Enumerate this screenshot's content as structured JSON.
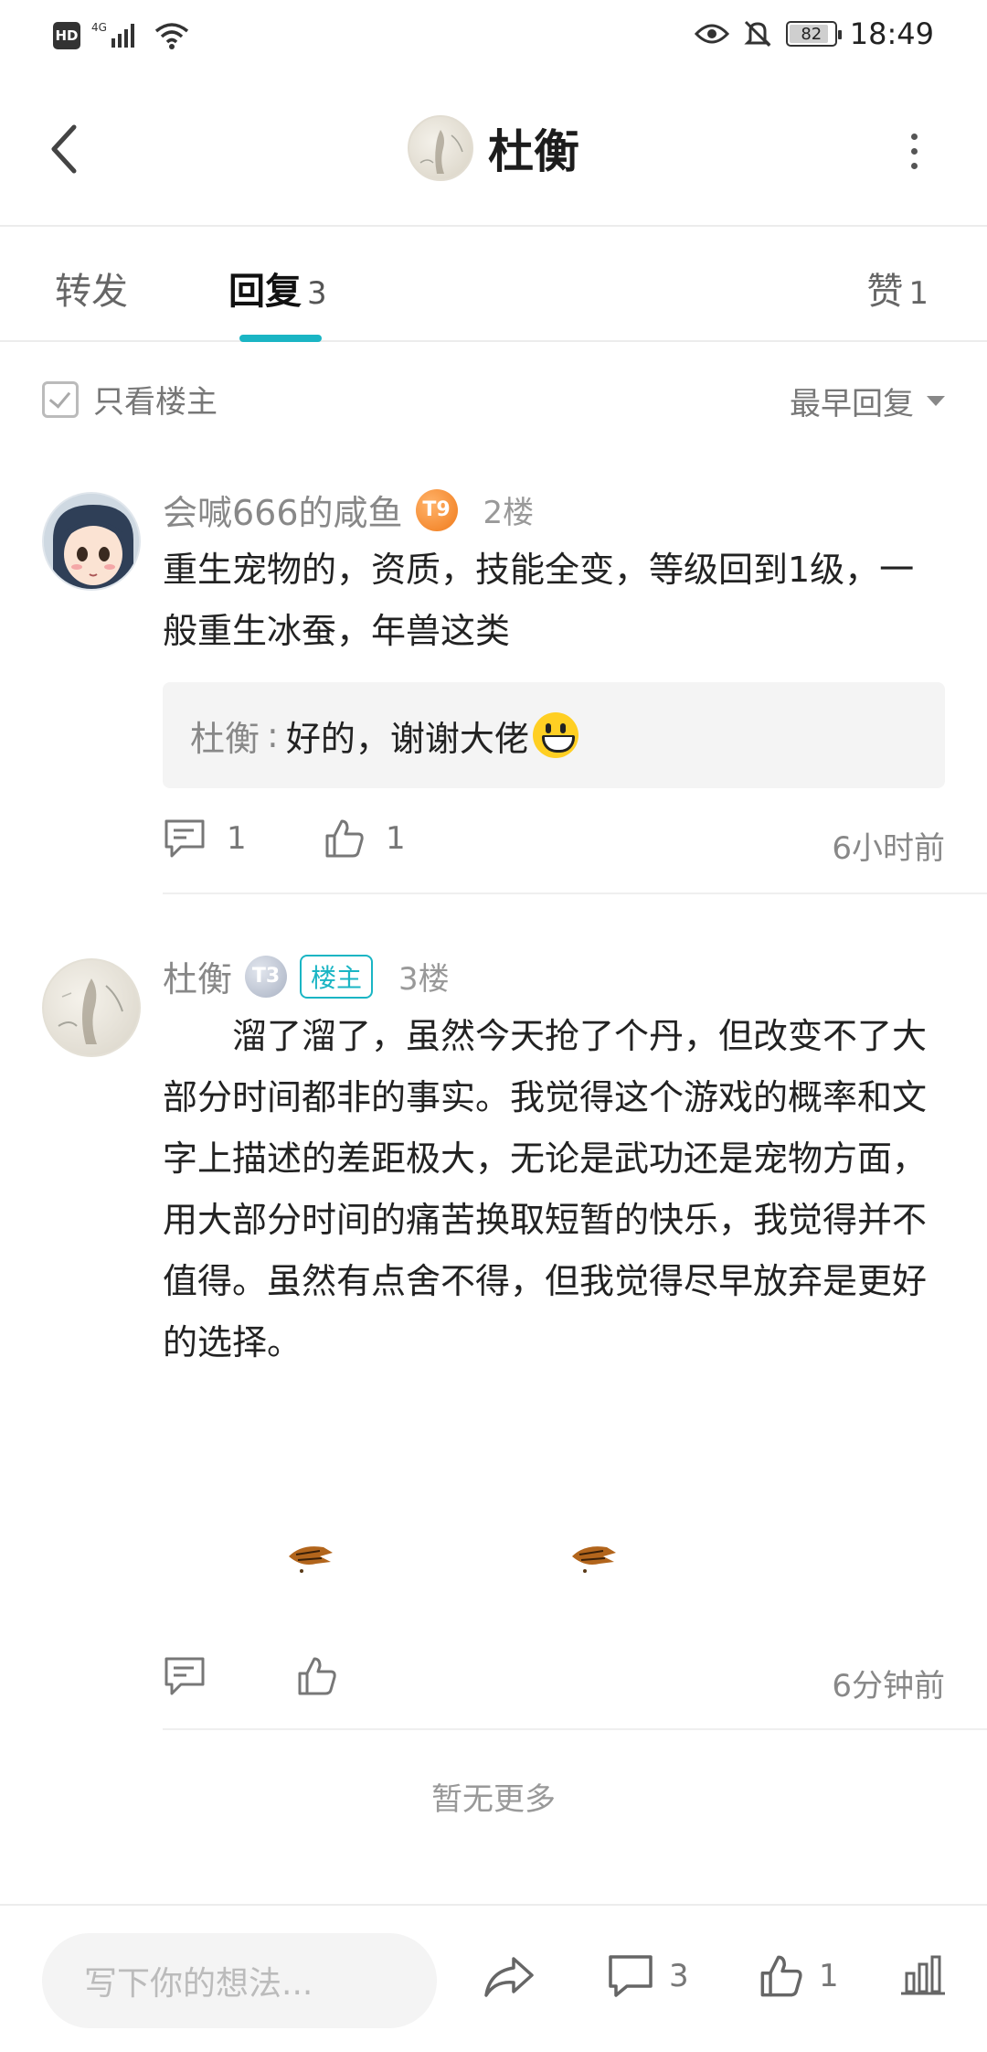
{
  "status_bar": {
    "network": "4G",
    "battery": "82",
    "time": "18:49",
    "hd_label": "HD"
  },
  "header": {
    "title": "杜衡"
  },
  "tabs": [
    {
      "label": "转发",
      "count": ""
    },
    {
      "label": "回复",
      "count": "3"
    },
    {
      "label": "赞",
      "count": "1"
    }
  ],
  "filter": {
    "only_op_label": "只看楼主",
    "sort_label": "最早回复"
  },
  "comments": [
    {
      "username": "会喊666的咸鱼",
      "level_icon": "T9",
      "floor": "2楼",
      "text": "重生宠物的，资质，技能全变，等级回到1级，一般重生冰蚕，年兽这类",
      "reply": {
        "name": "杜衡",
        "sep": ":",
        "text": "好的，谢谢大佬"
      },
      "reply_count": "1",
      "like_count": "1",
      "time": "6小时前"
    },
    {
      "username": "杜衡",
      "level_icon": "T3",
      "op_badge": "楼主",
      "floor": "3楼",
      "text": "　　溜了溜了，虽然今天抢了个丹，但改变不了大部分时间都非的事实。我觉得这个游戏的概率和文字上描述的差距极大，无论是武功还是宠物方面，用大部分时间的痛苦换取短暂的快乐，我觉得并不值得。虽然有点舍不得，但我觉得尽早放弃是更好的选择。",
      "time": "6分钟前"
    }
  ],
  "no_more": "暂无更多",
  "bottom_bar": {
    "input_placeholder": "写下你的想法...",
    "comment_count": "3",
    "like_count": "1"
  },
  "colors": {
    "accent": "#1ab5c4",
    "level_orange": "#f07a1a"
  },
  "icons": [
    "back-arrow-icon",
    "more-icon",
    "checkbox-icon",
    "caret-down-icon",
    "comment-icon",
    "thumb-up-icon",
    "share-icon",
    "chart-icon"
  ]
}
